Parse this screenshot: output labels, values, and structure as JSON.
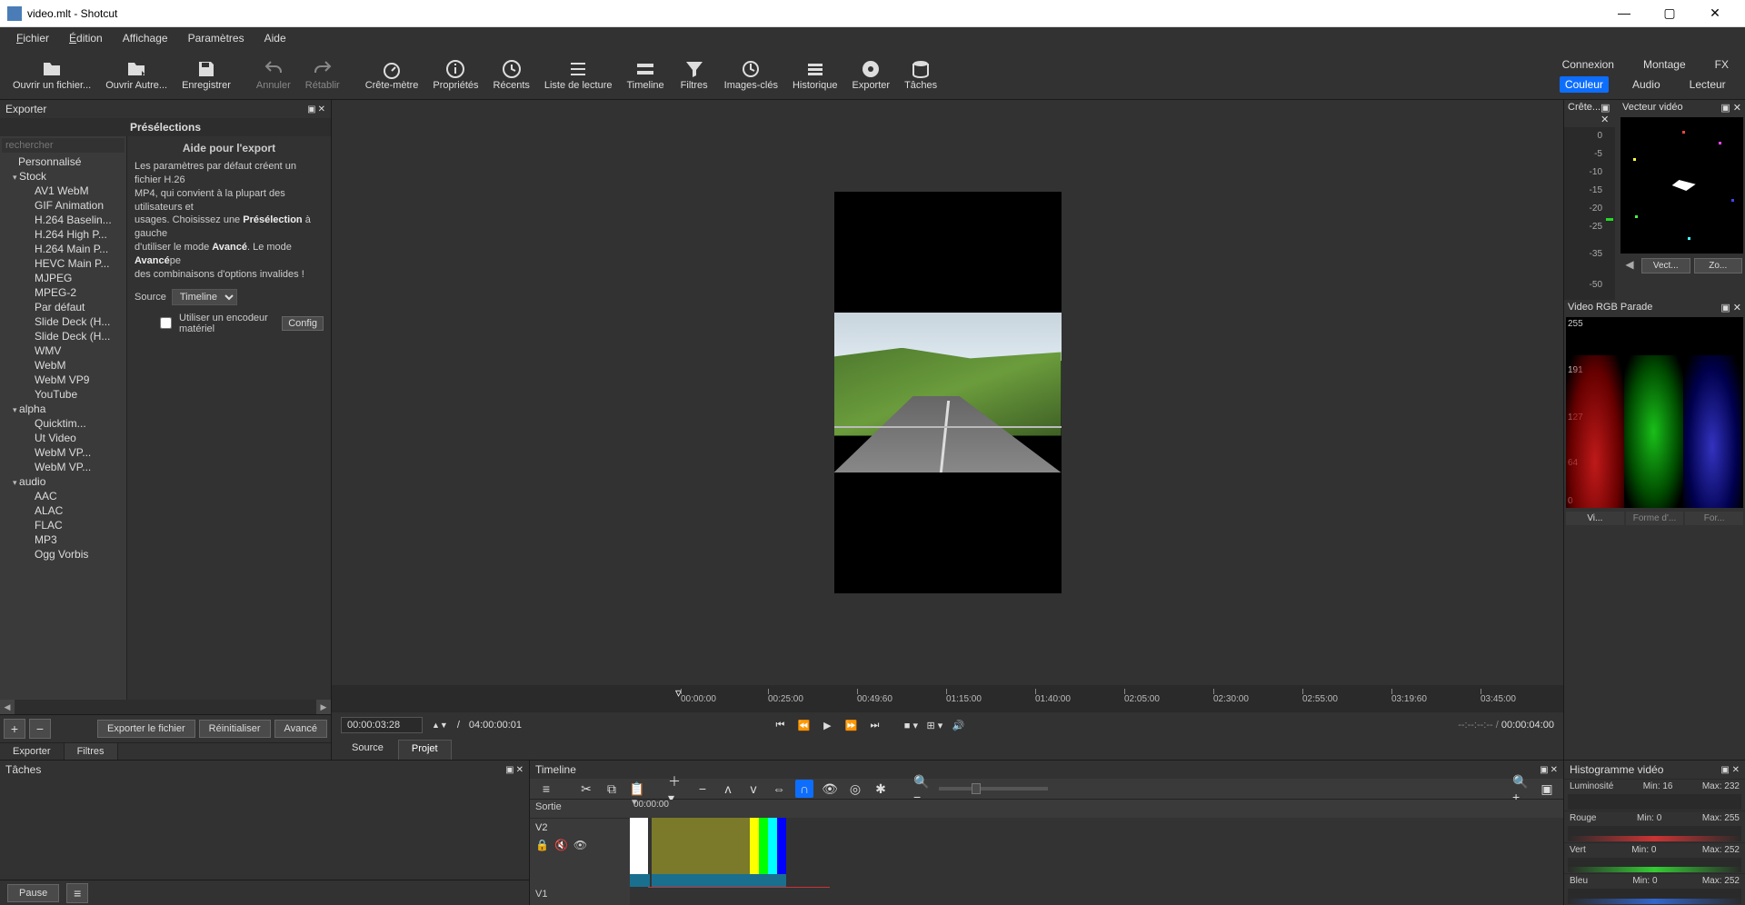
{
  "window": {
    "title": "video.mlt - Shotcut"
  },
  "titlebar_controls": {
    "min": "—",
    "max": "▢",
    "close": "✕"
  },
  "menu": {
    "file": "Fichier",
    "edit": "Édition",
    "view": "Affichage",
    "settings": "Paramètres",
    "help": "Aide"
  },
  "toolbar": {
    "open": "Ouvrir un fichier...",
    "open_other": "Ouvrir Autre...",
    "save": "Enregistrer",
    "undo": "Annuler",
    "redo": "Rétablir",
    "peak": "Crête-mètre",
    "props": "Propriétés",
    "recent": "Récents",
    "playlist": "Liste de lecture",
    "timeline": "Timeline",
    "filters": "Filtres",
    "keyframes": "Images-clés",
    "history": "Historique",
    "export": "Exporter",
    "jobs": "Tâches"
  },
  "topright": {
    "row1": {
      "connexion": "Connexion",
      "montage": "Montage",
      "fx": "FX"
    },
    "row2": {
      "couleur": "Couleur",
      "audio": "Audio",
      "lecteur": "Lecteur"
    }
  },
  "export_panel": {
    "title": "Exporter",
    "presets_title": "Présélections",
    "search_placeholder": "rechercher",
    "tree": {
      "custom": "Personnalisé",
      "stock": "Stock",
      "stock_items": [
        "AV1 WebM",
        "GIF Animation",
        "H.264 Baselin...",
        "H.264 High P...",
        "H.264 Main P...",
        "HEVC Main P...",
        "MJPEG",
        "MPEG-2",
        "Par défaut",
        "Slide Deck (H...",
        "Slide Deck (H...",
        "WMV",
        "WebM",
        "WebM VP9",
        "YouTube"
      ],
      "alpha": "alpha",
      "alpha_items": [
        "Quicktim...",
        "Ut Video",
        "WebM VP...",
        "WebM VP..."
      ],
      "audio": "audio",
      "audio_items": [
        "AAC",
        "ALAC",
        "FLAC",
        "MP3",
        "Ogg Vorbis"
      ]
    },
    "help_title": "Aide pour l'export",
    "help_text_1": "Les paramètres par défaut créent un fichier H.26",
    "help_text_2": "MP4, qui convient à la plupart des utilisateurs et",
    "help_text_3a": "usages. Choisissez une ",
    "help_text_3b": "Présélection",
    "help_text_3c": " à gauche",
    "help_text_4a": "d'utiliser le mode ",
    "help_text_4b": "Avancé",
    "help_text_4c": ". Le mode ",
    "help_text_4d": "Avancé",
    "help_text_4e": "pe",
    "help_text_5": "des combinaisons d'options invalides !",
    "source_label": "Source",
    "source_value": "Timeline",
    "hw_label": "Utiliser un encodeur matériel",
    "config_btn": "Config",
    "export_file": "Exporter le fichier",
    "reset": "Réinitialiser",
    "advanced": "Avancé",
    "tab_exporter": "Exporter",
    "tab_filtres": "Filtres"
  },
  "tasks_panel": {
    "title": "Tâches",
    "pause": "Pause"
  },
  "player": {
    "ruler": [
      "00:00:00",
      "00:25:00",
      "00:49:60",
      "01:15:00",
      "01:40:00",
      "02:05:00",
      "02:30:00",
      "02:55:00",
      "03:19:60",
      "03:45:00"
    ],
    "tc_current": "00:00:03:28",
    "tc_sep": "/",
    "tc_total": "04:00:00:01",
    "tc_right_blank": "--:--:--:--  /",
    "tc_right_dur": "00:00:04:00",
    "tab_source": "Source",
    "tab_project": "Projet"
  },
  "scopes": {
    "crete_title": "Crête...",
    "crete_marks": [
      "0",
      "-5",
      "-10",
      "-15",
      "-20",
      "-25",
      "-35",
      "-50"
    ],
    "vec_title": "Vecteur vidéo",
    "vec_btn": "Vect...",
    "zoom_btn": "Zo...",
    "rgb_title": "Video RGB Parade",
    "rgb_marks": [
      "255",
      "191",
      "127",
      "64",
      "0"
    ],
    "rgb_tabs": [
      "Vi...",
      "Forme d'...",
      "For..."
    ]
  },
  "timeline_panel": {
    "title": "Timeline",
    "sortie": "Sortie",
    "ruler_start": "00:00:00",
    "track_v2": "V2",
    "track_v1": "V1"
  },
  "histo_panel": {
    "title": "Histogramme vidéo",
    "rows": [
      {
        "name": "Luminosité",
        "min": "Min: 16",
        "max": "Max: 232"
      },
      {
        "name": "Rouge",
        "min": "Min: 0",
        "max": "Max: 255"
      },
      {
        "name": "Vert",
        "min": "Min: 0",
        "max": "Max: 252"
      },
      {
        "name": "Bleu",
        "min": "Min: 0",
        "max": "Max: 252"
      }
    ]
  }
}
